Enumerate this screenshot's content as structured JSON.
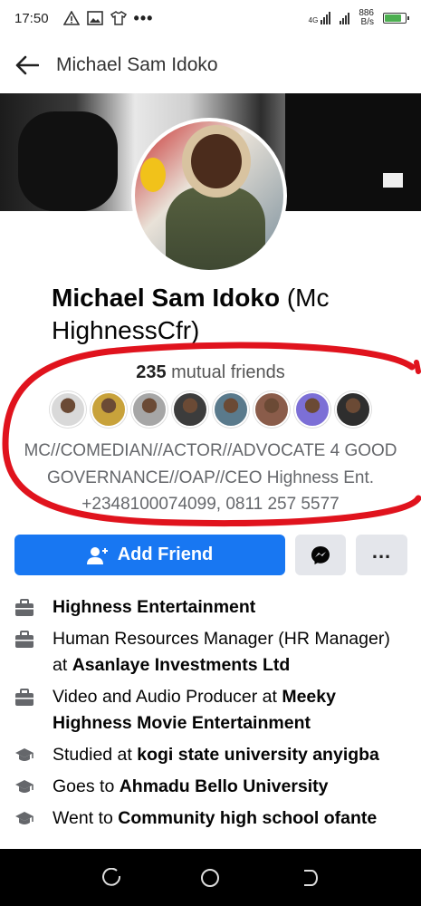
{
  "status_bar": {
    "time": "17:50",
    "signal_label": "4G",
    "net_speed_value": "886",
    "net_speed_unit": "B/s",
    "battery_level": 0.85
  },
  "header": {
    "back_icon": "back-arrow-icon",
    "title": "Michael Sam Idoko"
  },
  "profile": {
    "name_bold": "Michael Sam Idoko",
    "name_rest": " (Mc HighnessCfr)",
    "mutual_count": "235",
    "mutual_label": " mutual friends",
    "mutual_friend_colors": [
      "#d9d9d9",
      "#c8a23b",
      "#a6a6a6",
      "#3c3c3c",
      "#5a7a8c",
      "#8a5c4a",
      "#7c6fd6",
      "#2e2e2e"
    ],
    "bio": "MC//COMEDIAN//ACTOR//ADVOCATE 4 GOOD GOVERNANCE//OAP//CEO Highness Ent. +2348100074099, 0811 257 5577"
  },
  "actions": {
    "add_friend_label": "Add Friend",
    "messenger_icon": "messenger-icon",
    "more_icon": "more-icon"
  },
  "info": [
    {
      "icon": "briefcase-icon",
      "prefix": "",
      "bold": "Highness Entertainment"
    },
    {
      "icon": "briefcase-icon",
      "prefix": "Human Resources Manager (HR Manager) at ",
      "bold": "Asanlaye Investments Ltd"
    },
    {
      "icon": "briefcase-icon",
      "prefix": "Video and Audio Producer at ",
      "bold": "Meeky Highness Movie Entertainment"
    },
    {
      "icon": "graduation-cap-icon",
      "prefix": "Studied at ",
      "bold": "kogi state university anyigba"
    },
    {
      "icon": "graduation-cap-icon",
      "prefix": "Goes to ",
      "bold": "Ahmadu Bello University"
    },
    {
      "icon": "graduation-cap-icon",
      "prefix": "Went to ",
      "bold": "Community high school ofante"
    }
  ],
  "colors": {
    "accent": "#1877f2",
    "annotation": "#e0131d"
  }
}
